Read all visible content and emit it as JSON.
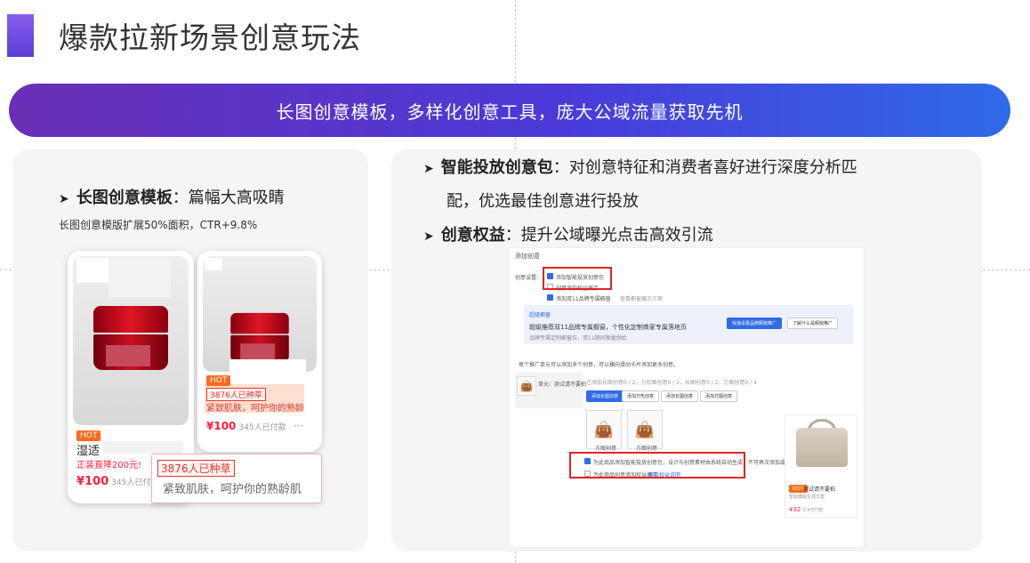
{
  "header": {
    "title": "爆款拉新场景创意玩法"
  },
  "banner": {
    "text": "长图创意模板，多样化创意工具，庞大公域流量获取先机"
  },
  "left": {
    "bullet_bold": "长图创意模板",
    "bullet_rest": "：篇幅大高吸睛",
    "note": "长图创意模版扩展50%面积，CTR+9.8%",
    "phone1": {
      "hot": "HOT",
      "name": "湿适",
      "promo": "正装直降200元!",
      "price": "¥100",
      "paid": "345人已付款"
    },
    "phone2": {
      "hot": "HOT",
      "tag": "3876人已种草",
      "line": "紧致肌肤，呵护你的熟龄",
      "price": "¥100",
      "paid": "345人已付款",
      "dots": "···"
    },
    "zoom": {
      "tag": "3876人已种草",
      "line": "紧致肌肤，呵护你的熟龄肌"
    }
  },
  "right": {
    "bullet1_bold": "智能投放创意包",
    "bullet1_rest": "：对创意特征和消费者喜好进行深度分析匹",
    "bullet1_cont": "配，优选最佳创意进行投放",
    "bullet2_bold": "创意权益",
    "bullet2_rest": "：提升公域曝光点击高效引流",
    "form": {
      "title": "添加创意",
      "label": "创意设置：",
      "opt1": "添加智能投放创意包",
      "opt2": "创意添加权益展示",
      "opt3": "添加双11品牌专属橱窗",
      "opt3_link": "查看橱窗展示方案",
      "info_title": "超级橱窗",
      "info_line": "超级推荐双11品牌专属橱窗，个性化定制商家专属落地页",
      "info_sub": "品牌专属定制橱窗位，双11期间限量供给",
      "btn_primary": "快速设置品牌橱窗推广",
      "btn_secondary": "了解什么是橱窗推广",
      "hint": "每个推广单元可以添加多个创意，可以横向滑动卡片添加更多创意。",
      "unit": "单元：测试请不要拍",
      "counts": "已添加长图创意0 / 2，方形图创意0 / 2，长图创意0 / 2，方图创意0 / 4",
      "tabs": [
        "添加长图创意",
        "添加方形创意",
        "添加长图创意",
        "添加方图创意"
      ],
      "thumb1": "方图创意",
      "thumb2": "方图创意",
      "check1": "为此商品添加智能投放创意包，设计与创意素材由系统自动生成，不可再次添加或编辑。",
      "check2": "为此商品创意添加权益展示",
      "check2_link": "查看权益说明",
      "preview_tag": "HOT",
      "preview_name": "测试请不要拍",
      "preview_sub": "智能模版生成文案",
      "preview_price": "¥32",
      "preview_paid": "2.4万付款"
    }
  },
  "colors": {
    "accent": "#6a2fb5",
    "blue": "#2f6ae8",
    "red": "#ff1f3d",
    "frame": "#e02424"
  }
}
